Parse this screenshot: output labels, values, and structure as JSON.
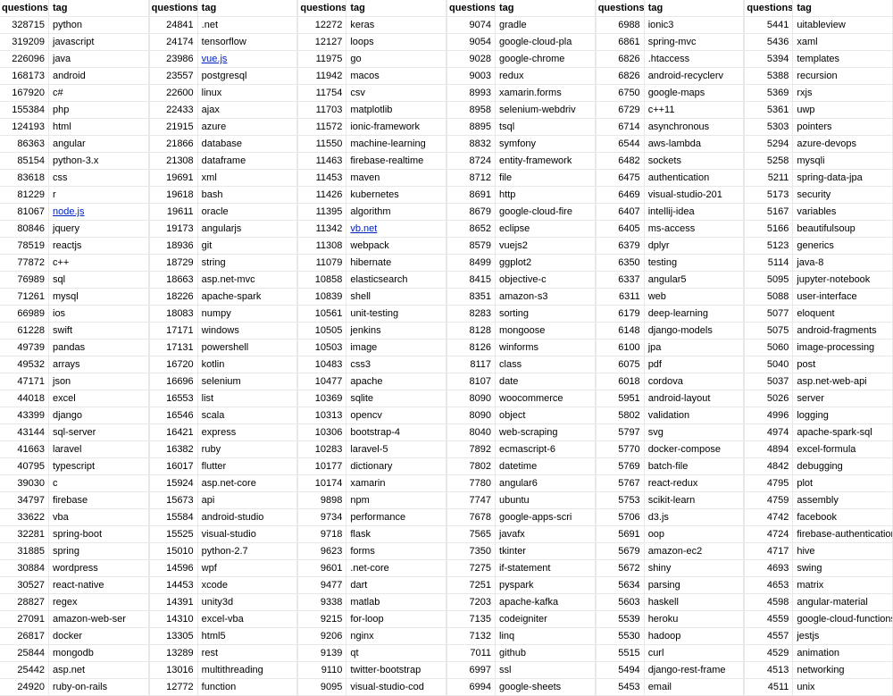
{
  "headers": {
    "q": "questions",
    "t": "tag"
  },
  "chart_data": {
    "type": "table",
    "title": "",
    "columns_per_group": [
      "questions",
      "tag"
    ],
    "groups": 6,
    "links": [
      "node.js",
      "vue.js",
      "vb.net"
    ],
    "columns": [
      [
        {
          "q": 328715,
          "t": "python"
        },
        {
          "q": 319209,
          "t": "javascript"
        },
        {
          "q": 226096,
          "t": "java"
        },
        {
          "q": 168173,
          "t": "android"
        },
        {
          "q": 167920,
          "t": "c#"
        },
        {
          "q": 155384,
          "t": "php"
        },
        {
          "q": 124193,
          "t": "html"
        },
        {
          "q": 86363,
          "t": "angular"
        },
        {
          "q": 85154,
          "t": "python-3.x"
        },
        {
          "q": 83618,
          "t": "css"
        },
        {
          "q": 81229,
          "t": "r"
        },
        {
          "q": 81067,
          "t": "node.js"
        },
        {
          "q": 80846,
          "t": "jquery"
        },
        {
          "q": 78519,
          "t": "reactjs"
        },
        {
          "q": 77872,
          "t": "c++"
        },
        {
          "q": 76989,
          "t": "sql"
        },
        {
          "q": 71261,
          "t": "mysql"
        },
        {
          "q": 66989,
          "t": "ios"
        },
        {
          "q": 61228,
          "t": "swift"
        },
        {
          "q": 49739,
          "t": "pandas"
        },
        {
          "q": 49532,
          "t": "arrays"
        },
        {
          "q": 47171,
          "t": "json"
        },
        {
          "q": 44018,
          "t": "excel"
        },
        {
          "q": 43399,
          "t": "django"
        },
        {
          "q": 43144,
          "t": "sql-server"
        },
        {
          "q": 41663,
          "t": "laravel"
        },
        {
          "q": 40795,
          "t": "typescript"
        },
        {
          "q": 39030,
          "t": "c"
        },
        {
          "q": 34797,
          "t": "firebase"
        },
        {
          "q": 33622,
          "t": "vba"
        },
        {
          "q": 32281,
          "t": "spring-boot"
        },
        {
          "q": 31885,
          "t": "spring"
        },
        {
          "q": 30884,
          "t": "wordpress"
        },
        {
          "q": 30527,
          "t": "react-native"
        },
        {
          "q": 28827,
          "t": "regex"
        },
        {
          "q": 27091,
          "t": "amazon-web-ser"
        },
        {
          "q": 26817,
          "t": "docker"
        },
        {
          "q": 25844,
          "t": "mongodb"
        },
        {
          "q": 25442,
          "t": "asp.net"
        },
        {
          "q": 24920,
          "t": "ruby-on-rails"
        }
      ],
      [
        {
          "q": 24841,
          "t": ".net"
        },
        {
          "q": 24174,
          "t": "tensorflow"
        },
        {
          "q": 23986,
          "t": "vue.js"
        },
        {
          "q": 23557,
          "t": "postgresql"
        },
        {
          "q": 22600,
          "t": "linux"
        },
        {
          "q": 22433,
          "t": "ajax"
        },
        {
          "q": 21915,
          "t": "azure"
        },
        {
          "q": 21866,
          "t": "database"
        },
        {
          "q": 21308,
          "t": "dataframe"
        },
        {
          "q": 19691,
          "t": "xml"
        },
        {
          "q": 19618,
          "t": "bash"
        },
        {
          "q": 19611,
          "t": "oracle"
        },
        {
          "q": 19173,
          "t": "angularjs"
        },
        {
          "q": 18936,
          "t": "git"
        },
        {
          "q": 18729,
          "t": "string"
        },
        {
          "q": 18663,
          "t": "asp.net-mvc"
        },
        {
          "q": 18226,
          "t": "apache-spark"
        },
        {
          "q": 18083,
          "t": "numpy"
        },
        {
          "q": 17171,
          "t": "windows"
        },
        {
          "q": 17131,
          "t": "powershell"
        },
        {
          "q": 16720,
          "t": "kotlin"
        },
        {
          "q": 16696,
          "t": "selenium"
        },
        {
          "q": 16553,
          "t": "list"
        },
        {
          "q": 16546,
          "t": "scala"
        },
        {
          "q": 16421,
          "t": "express"
        },
        {
          "q": 16382,
          "t": "ruby"
        },
        {
          "q": 16017,
          "t": "flutter"
        },
        {
          "q": 15924,
          "t": "asp.net-core"
        },
        {
          "q": 15673,
          "t": "api"
        },
        {
          "q": 15584,
          "t": "android-studio"
        },
        {
          "q": 15525,
          "t": "visual-studio"
        },
        {
          "q": 15010,
          "t": "python-2.7"
        },
        {
          "q": 14596,
          "t": "wpf"
        },
        {
          "q": 14453,
          "t": "xcode"
        },
        {
          "q": 14391,
          "t": "unity3d"
        },
        {
          "q": 14310,
          "t": "excel-vba"
        },
        {
          "q": 13305,
          "t": "html5"
        },
        {
          "q": 13289,
          "t": "rest"
        },
        {
          "q": 13016,
          "t": "multithreading"
        },
        {
          "q": 12772,
          "t": "function"
        }
      ],
      [
        {
          "q": 12272,
          "t": "keras"
        },
        {
          "q": 12127,
          "t": "loops"
        },
        {
          "q": 11975,
          "t": "go"
        },
        {
          "q": 11942,
          "t": "macos"
        },
        {
          "q": 11754,
          "t": "csv"
        },
        {
          "q": 11703,
          "t": "matplotlib"
        },
        {
          "q": 11572,
          "t": "ionic-framework"
        },
        {
          "q": 11550,
          "t": "machine-learning"
        },
        {
          "q": 11463,
          "t": "firebase-realtime"
        },
        {
          "q": 11453,
          "t": "maven"
        },
        {
          "q": 11426,
          "t": "kubernetes"
        },
        {
          "q": 11395,
          "t": "algorithm"
        },
        {
          "q": 11342,
          "t": "vb.net"
        },
        {
          "q": 11308,
          "t": "webpack"
        },
        {
          "q": 11079,
          "t": "hibernate"
        },
        {
          "q": 10858,
          "t": "elasticsearch"
        },
        {
          "q": 10839,
          "t": "shell"
        },
        {
          "q": 10561,
          "t": "unit-testing"
        },
        {
          "q": 10505,
          "t": "jenkins"
        },
        {
          "q": 10503,
          "t": "image"
        },
        {
          "q": 10483,
          "t": "css3"
        },
        {
          "q": 10477,
          "t": "apache"
        },
        {
          "q": 10369,
          "t": "sqlite"
        },
        {
          "q": 10313,
          "t": "opencv"
        },
        {
          "q": 10306,
          "t": "bootstrap-4"
        },
        {
          "q": 10283,
          "t": "laravel-5"
        },
        {
          "q": 10177,
          "t": "dictionary"
        },
        {
          "q": 10174,
          "t": "xamarin"
        },
        {
          "q": 9898,
          "t": "npm"
        },
        {
          "q": 9734,
          "t": "performance"
        },
        {
          "q": 9718,
          "t": "flask"
        },
        {
          "q": 9623,
          "t": "forms"
        },
        {
          "q": 9601,
          "t": ".net-core"
        },
        {
          "q": 9477,
          "t": "dart"
        },
        {
          "q": 9338,
          "t": "matlab"
        },
        {
          "q": 9215,
          "t": "for-loop"
        },
        {
          "q": 9206,
          "t": "nginx"
        },
        {
          "q": 9139,
          "t": "qt"
        },
        {
          "q": 9110,
          "t": "twitter-bootstrap"
        },
        {
          "q": 9095,
          "t": "visual-studio-cod"
        }
      ],
      [
        {
          "q": 9074,
          "t": "gradle"
        },
        {
          "q": 9054,
          "t": "google-cloud-pla"
        },
        {
          "q": 9028,
          "t": "google-chrome"
        },
        {
          "q": 9003,
          "t": "redux"
        },
        {
          "q": 8993,
          "t": "xamarin.forms"
        },
        {
          "q": 8958,
          "t": "selenium-webdriv"
        },
        {
          "q": 8895,
          "t": "tsql"
        },
        {
          "q": 8832,
          "t": "symfony"
        },
        {
          "q": 8724,
          "t": "entity-framework"
        },
        {
          "q": 8712,
          "t": "file"
        },
        {
          "q": 8691,
          "t": "http"
        },
        {
          "q": 8679,
          "t": "google-cloud-fire"
        },
        {
          "q": 8652,
          "t": "eclipse"
        },
        {
          "q": 8579,
          "t": "vuejs2"
        },
        {
          "q": 8499,
          "t": "ggplot2"
        },
        {
          "q": 8415,
          "t": "objective-c"
        },
        {
          "q": 8351,
          "t": "amazon-s3"
        },
        {
          "q": 8283,
          "t": "sorting"
        },
        {
          "q": 8128,
          "t": "mongoose"
        },
        {
          "q": 8126,
          "t": "winforms"
        },
        {
          "q": 8117,
          "t": "class"
        },
        {
          "q": 8107,
          "t": "date"
        },
        {
          "q": 8090,
          "t": "woocommerce"
        },
        {
          "q": 8090,
          "t": "object"
        },
        {
          "q": 8040,
          "t": "web-scraping"
        },
        {
          "q": 7892,
          "t": "ecmascript-6"
        },
        {
          "q": 7802,
          "t": "datetime"
        },
        {
          "q": 7780,
          "t": "angular6"
        },
        {
          "q": 7747,
          "t": "ubuntu"
        },
        {
          "q": 7678,
          "t": "google-apps-scri"
        },
        {
          "q": 7565,
          "t": "javafx"
        },
        {
          "q": 7350,
          "t": "tkinter"
        },
        {
          "q": 7275,
          "t": "if-statement"
        },
        {
          "q": 7251,
          "t": "pyspark"
        },
        {
          "q": 7203,
          "t": "apache-kafka"
        },
        {
          "q": 7135,
          "t": "codeigniter"
        },
        {
          "q": 7132,
          "t": "linq"
        },
        {
          "q": 7011,
          "t": "github"
        },
        {
          "q": 6997,
          "t": "ssl"
        },
        {
          "q": 6994,
          "t": "google-sheets"
        }
      ],
      [
        {
          "q": 6988,
          "t": "ionic3"
        },
        {
          "q": 6861,
          "t": "spring-mvc"
        },
        {
          "q": 6826,
          "t": ".htaccess"
        },
        {
          "q": 6826,
          "t": "android-recyclerv"
        },
        {
          "q": 6750,
          "t": "google-maps"
        },
        {
          "q": 6729,
          "t": "c++11"
        },
        {
          "q": 6714,
          "t": "asynchronous"
        },
        {
          "q": 6544,
          "t": "aws-lambda"
        },
        {
          "q": 6482,
          "t": "sockets"
        },
        {
          "q": 6475,
          "t": "authentication"
        },
        {
          "q": 6469,
          "t": "visual-studio-201"
        },
        {
          "q": 6407,
          "t": "intellij-idea"
        },
        {
          "q": 6405,
          "t": "ms-access"
        },
        {
          "q": 6379,
          "t": "dplyr"
        },
        {
          "q": 6350,
          "t": "testing"
        },
        {
          "q": 6337,
          "t": "angular5"
        },
        {
          "q": 6311,
          "t": "web"
        },
        {
          "q": 6179,
          "t": "deep-learning"
        },
        {
          "q": 6148,
          "t": "django-models"
        },
        {
          "q": 6100,
          "t": "jpa"
        },
        {
          "q": 6075,
          "t": "pdf"
        },
        {
          "q": 6018,
          "t": "cordova"
        },
        {
          "q": 5951,
          "t": "android-layout"
        },
        {
          "q": 5802,
          "t": "validation"
        },
        {
          "q": 5797,
          "t": "svg"
        },
        {
          "q": 5770,
          "t": "docker-compose"
        },
        {
          "q": 5769,
          "t": "batch-file"
        },
        {
          "q": 5767,
          "t": "react-redux"
        },
        {
          "q": 5753,
          "t": "scikit-learn"
        },
        {
          "q": 5706,
          "t": "d3.js"
        },
        {
          "q": 5691,
          "t": "oop"
        },
        {
          "q": 5679,
          "t": "amazon-ec2"
        },
        {
          "q": 5672,
          "t": "shiny"
        },
        {
          "q": 5634,
          "t": "parsing"
        },
        {
          "q": 5603,
          "t": "haskell"
        },
        {
          "q": 5539,
          "t": "heroku"
        },
        {
          "q": 5530,
          "t": "hadoop"
        },
        {
          "q": 5515,
          "t": "curl"
        },
        {
          "q": 5494,
          "t": "django-rest-frame"
        },
        {
          "q": 5453,
          "t": "email"
        }
      ],
      [
        {
          "q": 5441,
          "t": "uitableview"
        },
        {
          "q": 5436,
          "t": "xaml"
        },
        {
          "q": 5394,
          "t": "templates"
        },
        {
          "q": 5388,
          "t": "recursion"
        },
        {
          "q": 5369,
          "t": "rxjs"
        },
        {
          "q": 5361,
          "t": "uwp"
        },
        {
          "q": 5303,
          "t": "pointers"
        },
        {
          "q": 5294,
          "t": "azure-devops"
        },
        {
          "q": 5258,
          "t": "mysqli"
        },
        {
          "q": 5211,
          "t": "spring-data-jpa"
        },
        {
          "q": 5173,
          "t": "security"
        },
        {
          "q": 5167,
          "t": "variables"
        },
        {
          "q": 5166,
          "t": "beautifulsoup"
        },
        {
          "q": 5123,
          "t": "generics"
        },
        {
          "q": 5114,
          "t": "java-8"
        },
        {
          "q": 5095,
          "t": "jupyter-notebook"
        },
        {
          "q": 5088,
          "t": "user-interface"
        },
        {
          "q": 5077,
          "t": "eloquent"
        },
        {
          "q": 5075,
          "t": "android-fragments"
        },
        {
          "q": 5060,
          "t": "image-processing"
        },
        {
          "q": 5040,
          "t": "post"
        },
        {
          "q": 5037,
          "t": "asp.net-web-api"
        },
        {
          "q": 5026,
          "t": "server"
        },
        {
          "q": 4996,
          "t": "logging"
        },
        {
          "q": 4974,
          "t": "apache-spark-sql"
        },
        {
          "q": 4894,
          "t": "excel-formula"
        },
        {
          "q": 4842,
          "t": "debugging"
        },
        {
          "q": 4795,
          "t": "plot"
        },
        {
          "q": 4759,
          "t": "assembly"
        },
        {
          "q": 4742,
          "t": "facebook"
        },
        {
          "q": 4724,
          "t": "firebase-authentication"
        },
        {
          "q": 4717,
          "t": "hive"
        },
        {
          "q": 4693,
          "t": "swing"
        },
        {
          "q": 4653,
          "t": "matrix"
        },
        {
          "q": 4598,
          "t": "angular-material"
        },
        {
          "q": 4559,
          "t": "google-cloud-functions"
        },
        {
          "q": 4557,
          "t": "jestjs"
        },
        {
          "q": 4529,
          "t": "animation"
        },
        {
          "q": 4513,
          "t": "networking"
        },
        {
          "q": 4511,
          "t": "unix"
        }
      ]
    ]
  }
}
